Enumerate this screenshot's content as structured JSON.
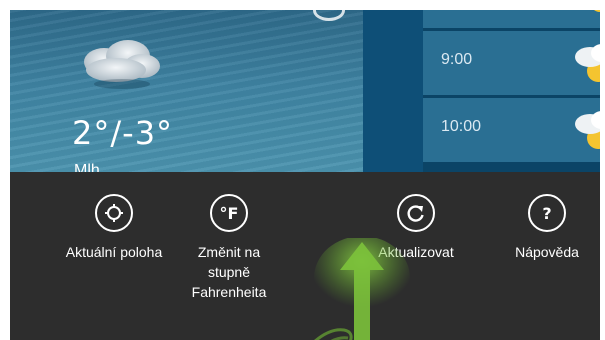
{
  "weather": {
    "temperature": "2°/-3°",
    "condition_partial": "Mlh",
    "icon": "cloud-icon"
  },
  "hourly": [
    {
      "time": "",
      "icon": "partly-sunny-icon"
    },
    {
      "time": "9:00",
      "icon": "partly-sunny-icon"
    },
    {
      "time": "10:00",
      "icon": "partly-sunny-icon"
    }
  ],
  "appbar": {
    "commands": [
      {
        "label": "Aktuální poloha",
        "icon": "location-target-icon"
      },
      {
        "label": "Změnit na stupně Fahrenheita",
        "icon": "fahrenheit-icon",
        "glyph": "°F"
      },
      {
        "label": "Aktualizovat",
        "icon": "refresh-icon"
      },
      {
        "label": "Nápověda",
        "icon": "help-icon",
        "glyph": "?"
      }
    ]
  },
  "colors": {
    "appbar_bg": "#2d2d2d",
    "tile_blue": "#2a6f93",
    "gesture_green": "#7cc23b"
  }
}
